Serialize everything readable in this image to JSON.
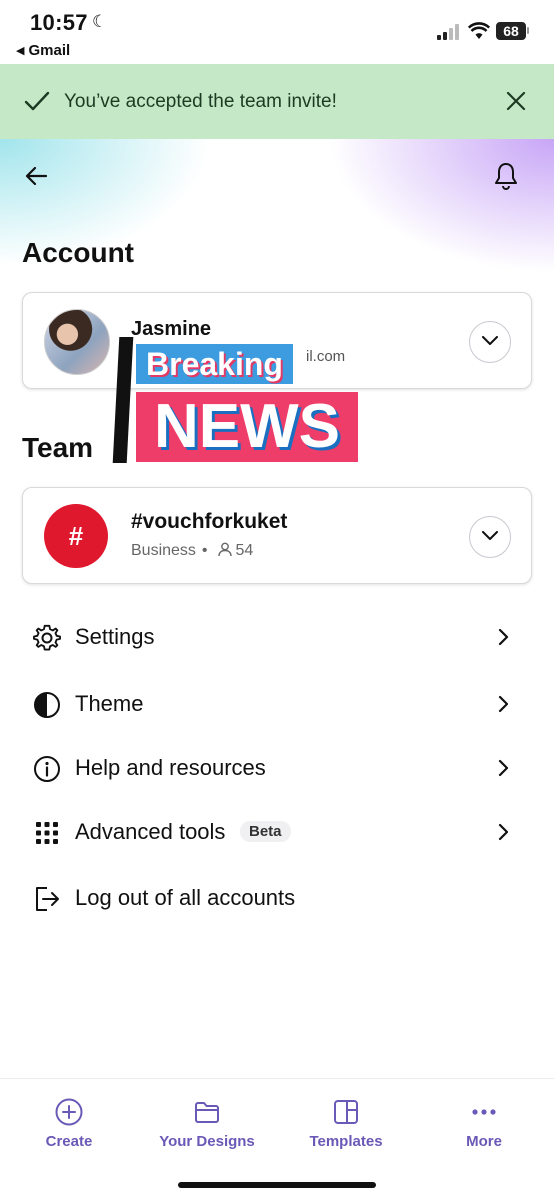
{
  "status_bar": {
    "time": "10:57",
    "back_app": "Gmail",
    "battery": "68"
  },
  "banner": {
    "message": "You’ve accepted the team invite!"
  },
  "account": {
    "section_title": "Account",
    "name": "Jasmine",
    "email_visible": "il.com"
  },
  "overlay": {
    "line1": "Breaking",
    "line2": "NEWS"
  },
  "team": {
    "section_title": "Team",
    "logo": "#",
    "name": "#vouchforkuket",
    "plan": "Business",
    "members": "54"
  },
  "menu": [
    {
      "label": "Settings",
      "icon": "gear-icon"
    },
    {
      "label": "Theme",
      "icon": "theme-icon"
    },
    {
      "label": "Help and resources",
      "icon": "info-icon"
    },
    {
      "label": "Advanced tools",
      "icon": "grid-icon",
      "badge": "Beta"
    },
    {
      "label": "Log out of all accounts",
      "icon": "logout-icon"
    }
  ],
  "bottom_nav": [
    {
      "label": "Create",
      "icon": "plus-circle-icon"
    },
    {
      "label": "Your Designs",
      "icon": "folder-icon"
    },
    {
      "label": "Templates",
      "icon": "templates-icon"
    },
    {
      "label": "More",
      "icon": "more-dots-icon"
    }
  ],
  "colors": {
    "banner": "#c5e9c7",
    "accent": "#6b59b7",
    "team_logo": "#e0182d"
  }
}
